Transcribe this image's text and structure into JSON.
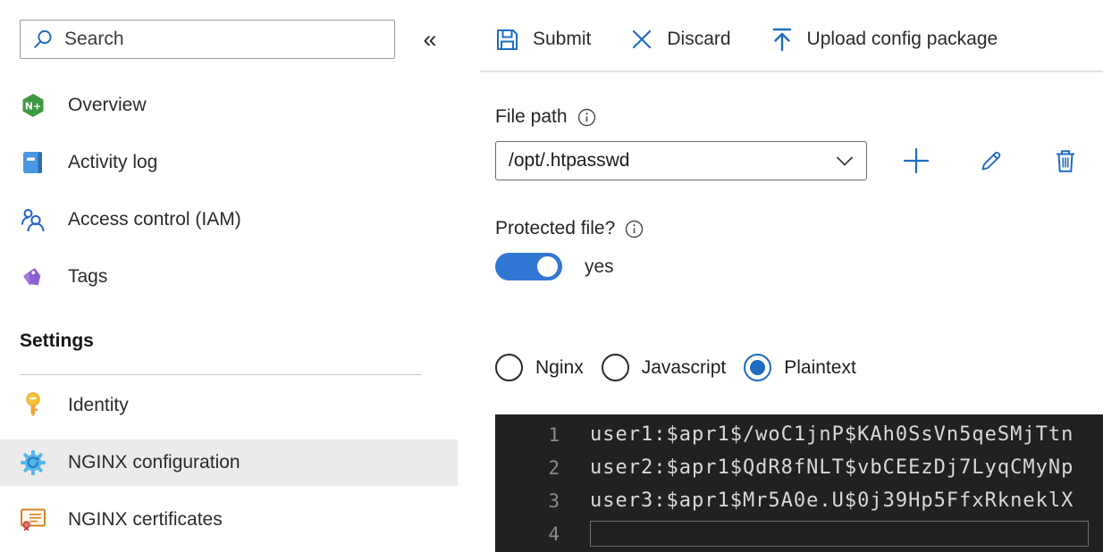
{
  "sidebar": {
    "search_placeholder": "Search",
    "collapse_glyph": "«",
    "items": [
      {
        "label": "Overview",
        "icon": "nginx-logo-icon"
      },
      {
        "label": "Activity log",
        "icon": "activity-log-icon"
      },
      {
        "label": "Access control (IAM)",
        "icon": "access-control-icon"
      },
      {
        "label": "Tags",
        "icon": "tag-icon"
      }
    ],
    "settings_heading": "Settings",
    "settings_items": [
      {
        "label": "Identity",
        "icon": "key-icon",
        "selected": false
      },
      {
        "label": "NGINX configuration",
        "icon": "gear-icon",
        "selected": true
      },
      {
        "label": "NGINX certificates",
        "icon": "certificate-icon",
        "selected": false
      }
    ]
  },
  "toolbar": {
    "submit_label": "Submit",
    "discard_label": "Discard",
    "upload_label": "Upload config package"
  },
  "form": {
    "file_path_label": "File path",
    "file_path_value": "/opt/.htpasswd",
    "protected_label": "Protected file?",
    "protected_value": "yes",
    "protected_enabled": true,
    "format_options": [
      {
        "label": "Nginx",
        "selected": false
      },
      {
        "label": "Javascript",
        "selected": false
      },
      {
        "label": "Plaintext",
        "selected": true
      }
    ]
  },
  "editor": {
    "lines": [
      {
        "number": "1",
        "text": "user1:$apr1$/woC1jnP$KAh0SsVn5qeSMjTtn"
      },
      {
        "number": "2",
        "text": "user2:$apr1$QdR8fNLT$vbCEEzDj7LyqCMyNp"
      },
      {
        "number": "3",
        "text": "user3:$apr1$Mr5A0e.U$0j39Hp5FfxRkneklX"
      },
      {
        "number": "4",
        "text": ""
      }
    ]
  },
  "colors": {
    "accent_blue": "#1f6cc0",
    "toggle_on": "#3377d4",
    "selected_row_bg": "#ebebeb",
    "editor_bg": "#212121",
    "editor_text": "#d8d8d8",
    "editor_line_number": "#8b8b8b",
    "nginx_green": "#3d9940",
    "tag_purple": "#8a5fd1",
    "key_gold": "#f2b71c",
    "gear_blue": "#56b6e8",
    "certificate_orange": "#d9822b"
  }
}
